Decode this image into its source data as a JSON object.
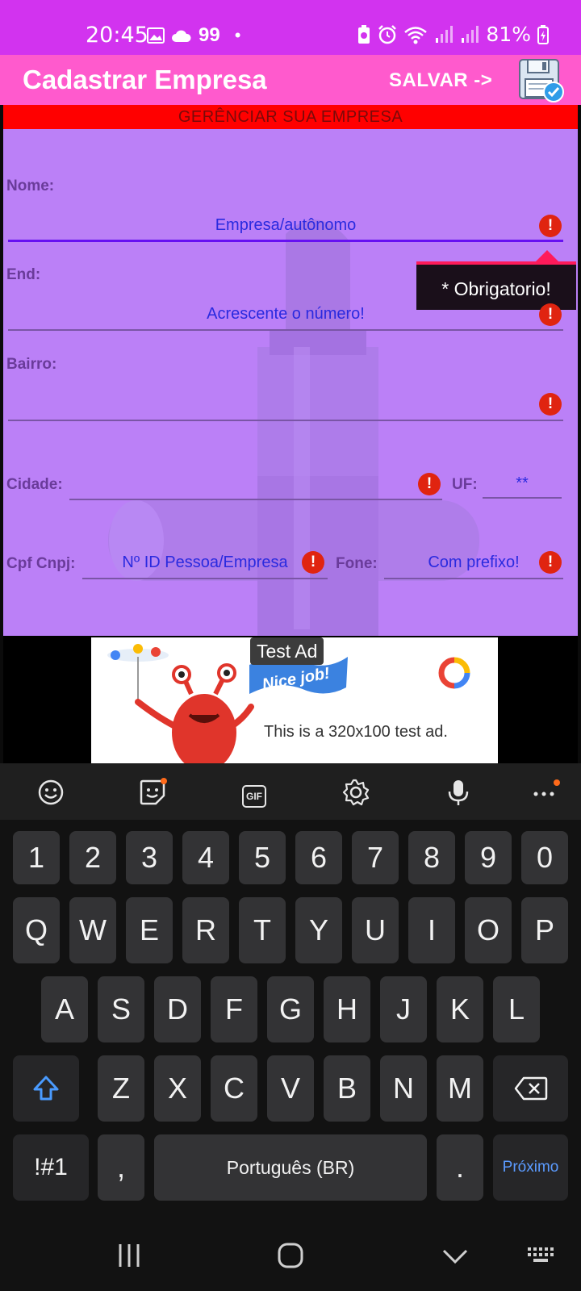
{
  "status_bar": {
    "time": "20:45",
    "left_icons": [
      "image-icon",
      "cloud-icon",
      "quote-icon",
      "dot-icon"
    ],
    "battery": "81%",
    "right_icons": [
      "battery-saver-icon",
      "alarm-icon",
      "wifi-icon",
      "signal-icon",
      "signal-icon",
      "battery-icon"
    ]
  },
  "appbar": {
    "title": "Cadastrar Empresa",
    "save_label": "SALVAR ->",
    "save_icon": "floppy-disk-check-icon"
  },
  "banner": "GERÊNCIAR SUA EMPRESA",
  "form": {
    "nome_label": "Nome:",
    "nome_value": "Empresa/autônomo",
    "end_label": "End:",
    "end_value": "Acrescente o número!",
    "bairro_label": "Bairro:",
    "bairro_value": "",
    "cidade_label": "Cidade:",
    "cidade_value": "",
    "uf_label": "UF:",
    "uf_value": "**",
    "cpf_label": "Cpf Cnpj:",
    "cpf_value": "Nº ID Pessoa/Empresa",
    "fone_label": "Fone:",
    "fone_value": "Com prefixo!",
    "error_glyph": "!",
    "tooltip": "* Obrigatorio!"
  },
  "ad": {
    "tag": "Test Ad",
    "flag_text": "Nice job!",
    "text": "This is a 320x100 test ad."
  },
  "keyboard": {
    "toolbar": [
      "emoji-icon",
      "sticker-icon",
      "gif-icon",
      "settings-icon",
      "mic-icon",
      "more-icon"
    ],
    "gif_label": "GIF",
    "row_numbers": [
      "1",
      "2",
      "3",
      "4",
      "5",
      "6",
      "7",
      "8",
      "9",
      "0"
    ],
    "row_q": [
      "Q",
      "W",
      "E",
      "R",
      "T",
      "Y",
      "U",
      "I",
      "O",
      "P"
    ],
    "row_a": [
      "A",
      "S",
      "D",
      "F",
      "G",
      "H",
      "J",
      "K",
      "L"
    ],
    "row_z": [
      "Z",
      "X",
      "C",
      "V",
      "B",
      "N",
      "M"
    ],
    "symbols": "!#1",
    "comma": ",",
    "space": "Português (BR)",
    "period": ".",
    "next": "Próximo"
  },
  "colors": {
    "status_bar": "#d233ef",
    "appbar": "#ff5acd",
    "content": "#bb80f7",
    "banner": "#ff0000",
    "error": "#e02410",
    "field_text": "#2a2adf",
    "next_key_text": "#5b9bff"
  }
}
